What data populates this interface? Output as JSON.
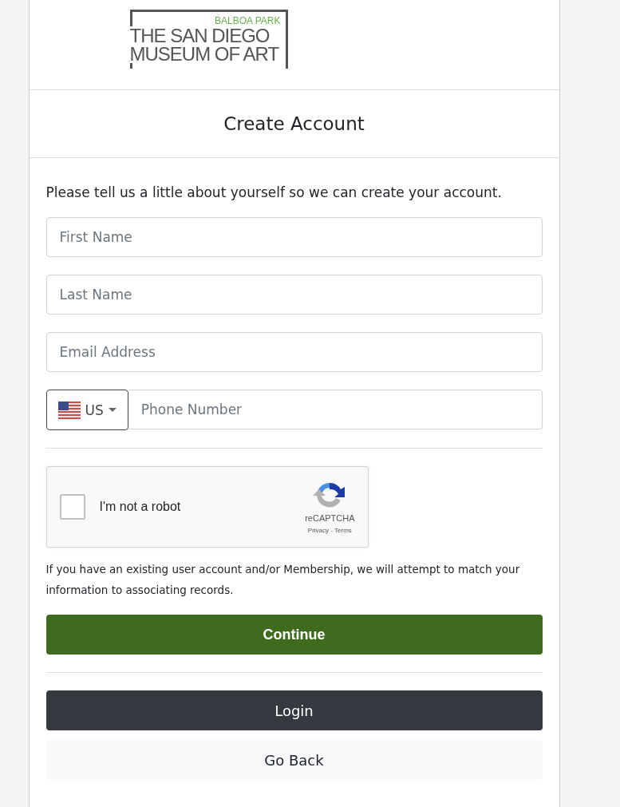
{
  "logo": {
    "tagline": "BALBOA PARK",
    "lines": [
      "THE SAN DIEGO",
      "MUSEUM OF ART"
    ]
  },
  "header": {
    "title": "Create Account"
  },
  "intro": "Please tell us a little about yourself so we can create your account.",
  "fields": [
    {
      "placeholder": "First Name"
    },
    {
      "placeholder": "Last Name"
    },
    {
      "placeholder": "Email Address"
    }
  ],
  "phone": {
    "country": "US",
    "placeholder": "Phone Number"
  },
  "captcha": {
    "label": "I'm not a robot",
    "checked": false,
    "brand": "reCAPTCHA",
    "links": "Privacy - Terms"
  },
  "notice": "If you have an existing user account and/or Membership, we will attempt to match your information to associating records.",
  "buttons": [
    {
      "label": "Continue",
      "kind": "primary"
    },
    {
      "label": "Login",
      "kind": "dark"
    },
    {
      "label": "Go Back",
      "kind": "light"
    }
  ]
}
